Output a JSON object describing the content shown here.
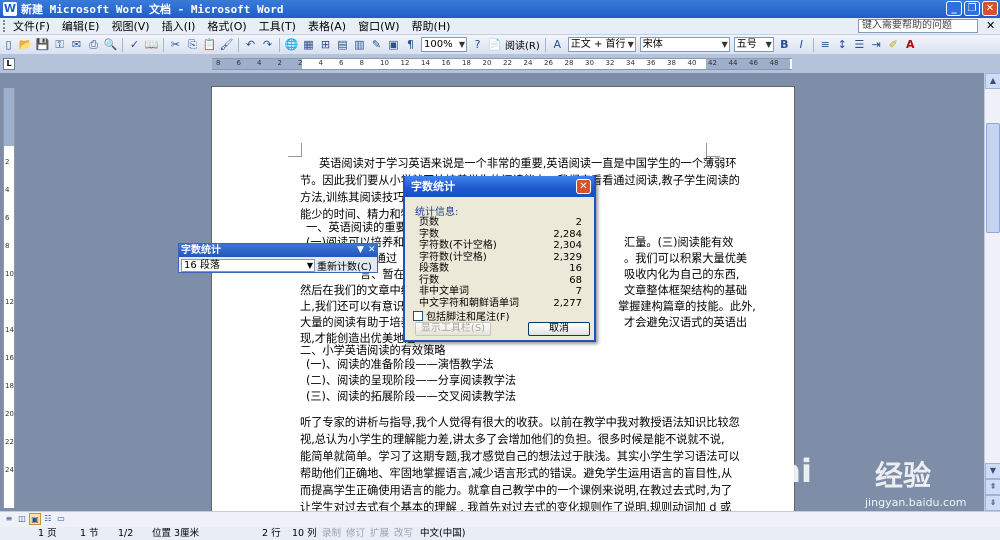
{
  "window": {
    "title": "新建 Microsoft Word 文档 - Microsoft Word"
  },
  "menu": {
    "items": [
      "文件(F)",
      "编辑(E)",
      "视图(V)",
      "插入(I)",
      "格式(O)",
      "工具(T)",
      "表格(A)",
      "窗口(W)",
      "帮助(H)"
    ],
    "help_placeholder": "键入需要帮助的问题"
  },
  "toolbar": {
    "zoom": "100%",
    "read_label": "阅读(R)",
    "style": "正文 + 首行",
    "font": "宋体",
    "size": "五号"
  },
  "ruler": {
    "ticks": [
      "8",
      "6",
      "4",
      "2",
      "2",
      "4",
      "6",
      "8",
      "10",
      "12",
      "14",
      "16",
      "18",
      "20",
      "22",
      "24",
      "26",
      "28",
      "30",
      "32",
      "34",
      "36",
      "38",
      "40",
      "42",
      "44",
      "46",
      "48"
    ],
    "vticks": [
      "2",
      "4",
      "6",
      "8",
      "10",
      "12",
      "14",
      "16",
      "18",
      "20",
      "22",
      "24"
    ]
  },
  "document": {
    "lines": [
      "英语阅读对于学习英语来说是一个非常的重要,英语阅读一直是中国学生的一个薄弱环",
      "节。因此我们要从小学就开始培养学生的阅读能力。我们来看看通过阅读,教子学生阅读的",
      "方法,训练其阅读技巧,                                                        学策略可以让教师花尽可",
      "能少的时间、精力和物力",
      "一、英语阅读的重要性",
      "(一)阅读可以培养和",
      "平,通过",
      "言、暂在",
      "然后在我们的文章中编",
      "上,我们还可以有意识地",
      "大量的阅读有助于培养孩",
      "现,才能创造出优美地道",
      "二、小学英语阅读的有效策略",
      "(一)、阅读的准备阶段——演悟教学法",
      "(二)、阅读的呈现阶段——分享阅读教学法",
      "(三)、阅读的拓展阶段——交叉阅读教学法",
      "听了专家的讲析与指导,我个人觉得有很大的收获。以前在教学中我对教授语法知识比较忽",
      "视,总认为小学生的理解能力差,讲太多了会增加他们的负担。很多时候是能不说就不说,",
      "能简单就简单。学习了这期专题,我才感觉自己的想法过于肤浅。其实小学生学习语法可以",
      "帮助他们正确地、牢固地掌握语言,减少语言形式的错误。避免学生运用语言的盲目性,从",
      "而提高学生正确使用语言的能力。就拿自己教学中的一个课例来说明,在教过去式时,为了",
      "让学生对过去式有个基本的理解 , 我首先对过去式的变化规则作了说明,规则动词加 d 或",
      "ed,不规则动词要牢记。然后出示了常规动词变化规则让学生进行记忆,但一段时间过后,只有某"
    ],
    "right_fragments": [
      "汇量。(三)阅读能有效",
      "。我们可以积累大量优美",
      "吸收内化为自己的东西,",
      "文章整体框架结构的基础",
      "掌握建构篇章的技能。此外,",
      "才会避免汉语式的英语出"
    ]
  },
  "word_count_toolbar": {
    "title": "字数统计",
    "selected": "16 段落",
    "recount_label": "重新计数(C)"
  },
  "dialog": {
    "title": "字数统计",
    "group_label": "统计信息:",
    "stats": [
      {
        "label": "页数",
        "value": "2"
      },
      {
        "label": "字数",
        "value": "2,284"
      },
      {
        "label": "字符数(不计空格)",
        "value": "2,304"
      },
      {
        "label": "字符数(计空格)",
        "value": "2,329"
      },
      {
        "label": "段落数",
        "value": "16"
      },
      {
        "label": "行数",
        "value": "68"
      },
      {
        "label": "非中文单词",
        "value": "7"
      },
      {
        "label": "中文字符和朝鲜语单词",
        "value": "2,277"
      }
    ],
    "checkbox_label": "包括脚注和尾注(F)",
    "show_toolbar_label": "显示工具栏(S)",
    "cancel_label": "取消"
  },
  "status": {
    "page": "1 页",
    "section": "1 节",
    "page_of": "1/2",
    "position": "位置 3厘米",
    "line": "2 行",
    "column": "10 列",
    "rec": "录制",
    "trk": "修订",
    "ext": "扩展",
    "ovr": "改写",
    "language": "中文(中国)"
  },
  "watermark": {
    "brand": "Bai",
    "brand2": "经验",
    "url": "jingyan.baidu.com"
  }
}
